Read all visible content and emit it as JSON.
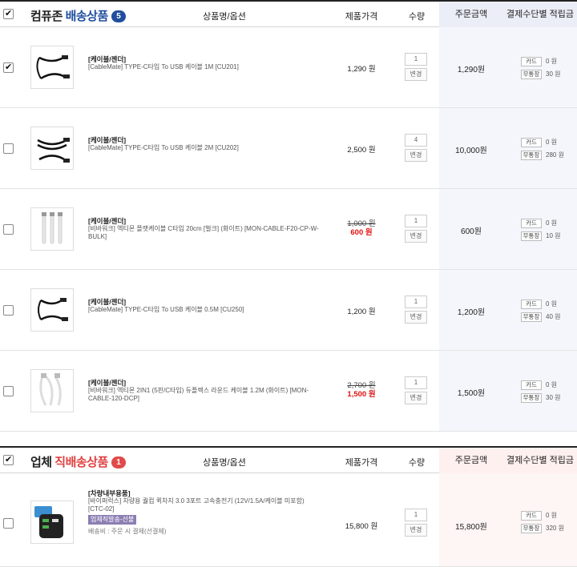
{
  "sections": [
    {
      "title_prefix": "컴퓨존 ",
      "title_highlight": "배송상품",
      "count": "5",
      "col_product": "상품명/옵션",
      "col_price": "제품가격",
      "col_qty": "수량",
      "col_order": "주문금액",
      "col_pay": "결제수단별 적립금",
      "items": [
        {
          "category": "[케이블/젠더]",
          "name": "[CableMate] TYPE-C타입 To USB 케이블 1M [CU201]",
          "price": "1,290 원",
          "qty": "1",
          "change": "변경",
          "order": "1,290원",
          "card_label": "카드",
          "card_val": "0 원",
          "cash_label": "무통장",
          "cash_val": "30 원",
          "checked": true
        },
        {
          "category": "[케이블/젠더]",
          "name": "[CableMate] TYPE-C타입 To USB 케이블 2M [CU202]",
          "price": "2,500 원",
          "qty": "4",
          "change": "변경",
          "order": "10,000원",
          "card_label": "카드",
          "card_val": "0 원",
          "cash_label": "무통장",
          "cash_val": "280 원",
          "checked": false
        },
        {
          "category": "[케이블/젠더]",
          "name": "[비바워크] 엑티몬 플랫케이블 C타입 20cm [벌크] (화이트) [MON-CABLE-F20-CP-W-BULK]",
          "orig_price": "1,000 원",
          "sale_price": "600 원",
          "qty": "1",
          "change": "변경",
          "order": "600원",
          "card_label": "카드",
          "card_val": "0 원",
          "cash_label": "무통장",
          "cash_val": "10 원",
          "checked": false
        },
        {
          "category": "[케이블/젠더]",
          "name": "[CableMate] TYPE-C타입 To USB 케이블 0.5M [CU250]",
          "price": "1,200 원",
          "qty": "1",
          "change": "변경",
          "order": "1,200원",
          "card_label": "카드",
          "card_val": "0 원",
          "cash_label": "무통장",
          "cash_val": "40 원",
          "checked": false
        },
        {
          "category": "[케이블/젠더]",
          "name": "[비바워크] 엑티몬 2IN1 (5핀/C타입) 듀플렉스 라운드 케이블 1.2M (화이트) [MON-CABLE-120-DCP]",
          "orig_price": "2,700 원",
          "sale_price": "1,500 원",
          "qty": "1",
          "change": "변경",
          "order": "1,500원",
          "card_label": "카드",
          "card_val": "0 원",
          "cash_label": "무통장",
          "cash_val": "30 원",
          "checked": false
        }
      ]
    },
    {
      "title_prefix": "업체 ",
      "title_highlight": "직배송상품",
      "count": "1",
      "col_product": "상품명/옵션",
      "col_price": "제품가격",
      "col_qty": "수량",
      "col_order": "주문금액",
      "col_pay": "결제수단별 적립금",
      "items": [
        {
          "category": "[차량내부용품]",
          "name": "[바이퍼럭스] 차량용 퀄컴 퀵차지 3.0 3포트 고속충전기 (12V/1.5A/케이블 미포함) [CTC-02]",
          "option_badge": "업체직발송-선불",
          "ship_label": "배송비 :",
          "ship_value": "주문 시 결제(선결제)",
          "price": "15,800 원",
          "qty": "1",
          "change": "변경",
          "order": "15,800원",
          "card_label": "카드",
          "card_val": "0 원",
          "cash_label": "무통장",
          "cash_val": "320 원",
          "checked": false
        }
      ]
    }
  ]
}
